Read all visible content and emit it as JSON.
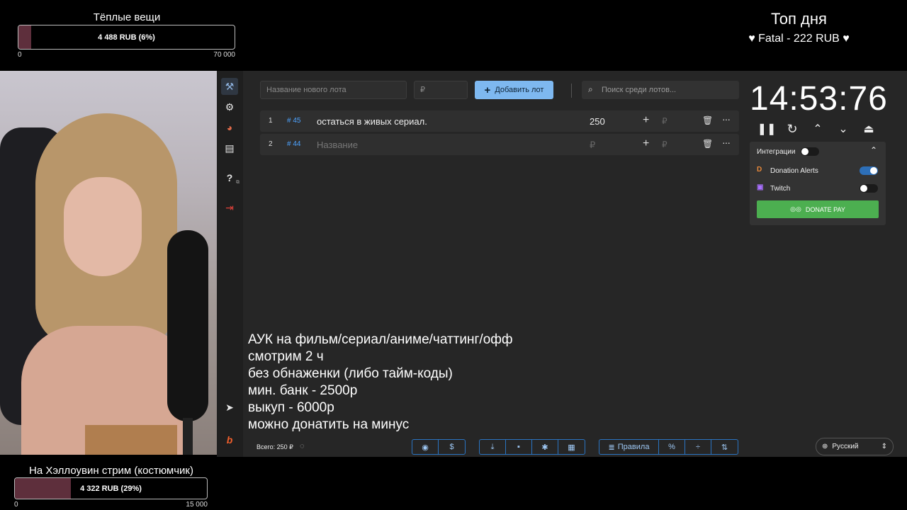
{
  "overlay": {
    "goal_top": {
      "title": "Тёплые вещи",
      "amount_text": "4 488 RUB (6%)",
      "min": "0",
      "max": "70 000",
      "progress": 0.06,
      "fill_color": "#5e2f3c"
    },
    "top_day": {
      "title": "Топ дня",
      "entry": "♥ Fatal - 222 RUB ♥"
    },
    "goal_bottom": {
      "title": "На Хэллоувин стрим (костюмчик)",
      "amount_text": "4 322 RUB (29%)",
      "min": "0",
      "max": "15 000",
      "progress": 0.29,
      "fill_color": "#5e2f3c"
    }
  },
  "sidebar": {
    "items": [
      {
        "icon": "gavel-icon",
        "glyph": "⚒"
      },
      {
        "icon": "gear-icon",
        "glyph": "⚙"
      },
      {
        "icon": "pie-chart-icon",
        "glyph": "◕"
      },
      {
        "icon": "clipboard-icon",
        "glyph": "▤"
      },
      {
        "icon": "help-icon",
        "glyph": "?"
      },
      {
        "icon": "logout-icon",
        "glyph": "⇥"
      },
      {
        "icon": "telegram-icon",
        "glyph": "➤"
      },
      {
        "icon": "boosty-icon",
        "glyph": "b"
      }
    ]
  },
  "toolbar": {
    "lot_name_placeholder": "Название нового лота",
    "lot_amount_placeholder": "₽",
    "add_lot_label": "Добавить лот",
    "search_placeholder": "Поиск среди лотов..."
  },
  "lots": [
    {
      "index": "1",
      "fast_id": "# 45",
      "name": "остаться в живых сериал.",
      "amount": "250",
      "rub": "₽"
    },
    {
      "index": "2",
      "fast_id": "# 44",
      "name": "Название",
      "amount": "₽",
      "rub": "₽"
    }
  ],
  "timer": {
    "value": "14:53:76",
    "controls": [
      "pause-icon",
      "restart-icon",
      "chevron-up-icon",
      "chevron-down-icon",
      "eject-icon"
    ]
  },
  "integrations": {
    "title": "Интеграции",
    "items": [
      {
        "name": "Donation Alerts",
        "enabled": true
      },
      {
        "name": "Twitch",
        "enabled": false
      }
    ],
    "donate_label": "DONATE PAY",
    "donate_color": "#4caf50"
  },
  "rules_text": "АУК на фильм/сериал/аниме/чаттинг/офф\nсмотрим 2 ч\nбез обнаженки (либо тайм-коды)\nмин. банк - 2500р\nвыкуп - 6000р\nможно донатить на минус",
  "footer": {
    "total": "Всего: 250 ₽",
    "group1": [
      "github-icon",
      "dollar-icon"
    ],
    "group2": [
      "download-icon",
      "save-icon",
      "bug-icon",
      "archive-icon"
    ],
    "rules_label": "Правила",
    "group3": [
      "percent-icon",
      "split-icon",
      "sort-icon"
    ],
    "language": "Русский"
  },
  "accent_color": "#7eb8f0"
}
